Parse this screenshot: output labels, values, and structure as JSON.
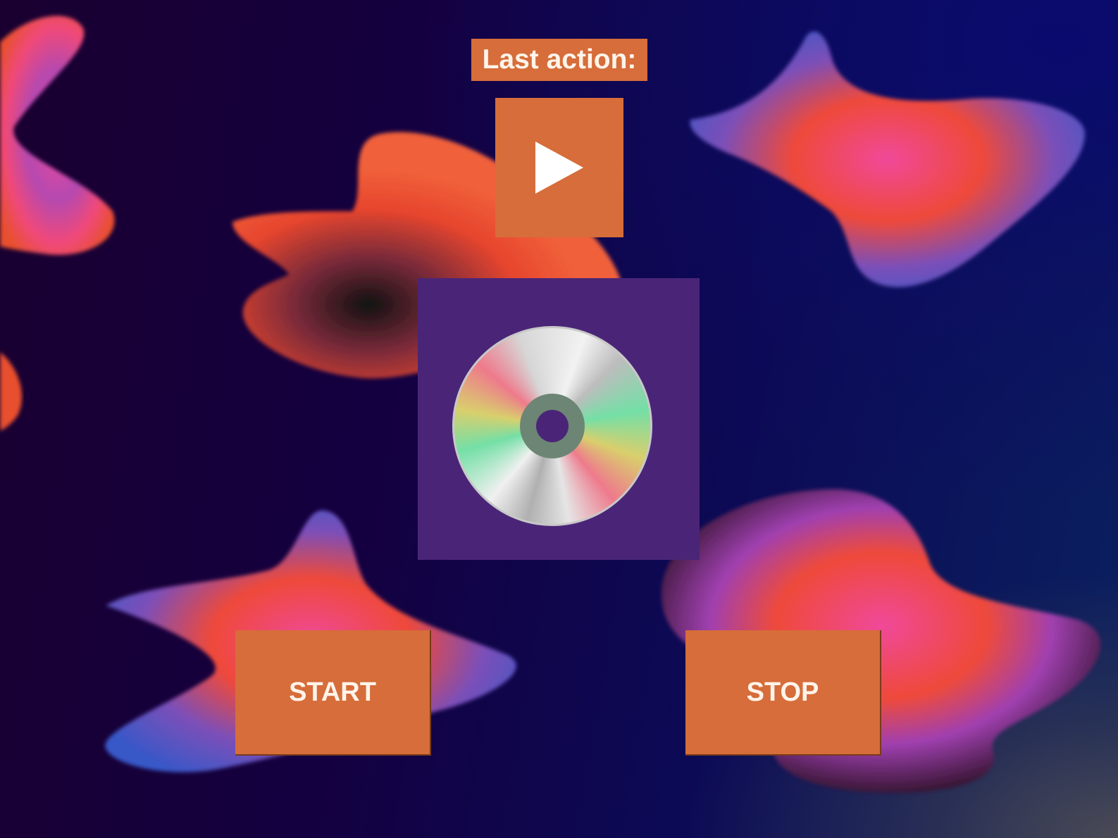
{
  "status": {
    "label": "Last action:"
  },
  "controls": {
    "play_icon": "play-triangle-icon",
    "disc_icon": "cd-disc-icon",
    "start_label": "START",
    "stop_label": "STOP"
  },
  "colors": {
    "button": "#d66d3a",
    "button_text": "#fff4ea",
    "disc_panel": "#4a2577",
    "background": "#140040"
  }
}
